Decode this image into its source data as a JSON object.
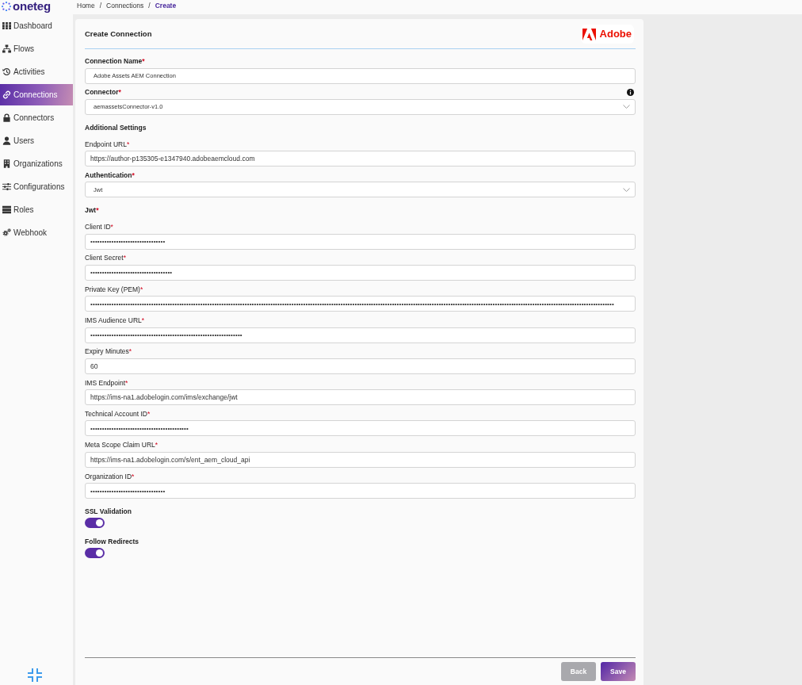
{
  "header": {
    "logo": "oneteg",
    "breadcrumb": [
      {
        "label": "Home",
        "selected": false,
        "separator": "/"
      },
      {
        "label": "Connections",
        "selected": false,
        "separator": "/"
      },
      {
        "label": "Create",
        "selected": true
      }
    ]
  },
  "sidebar": {
    "items": [
      {
        "label": "Dashboard",
        "selected": false
      },
      {
        "label": "Flows",
        "selected": false
      },
      {
        "label": "Activities",
        "selected": false
      },
      {
        "label": "Connections",
        "selected": true
      },
      {
        "label": "Connectors",
        "selected": false
      },
      {
        "label": "Users",
        "selected": false
      },
      {
        "label": "Organizations",
        "selected": false
      },
      {
        "label": "Configurations",
        "selected": false
      },
      {
        "label": "Roles",
        "selected": false
      },
      {
        "label": "Webhook",
        "selected": false
      }
    ]
  },
  "form": {
    "title": "Create Connection",
    "brand": "Adobe",
    "fields": [
      {
        "kind": "text",
        "bold": true,
        "label": "Connection Name",
        "required_mark": "*",
        "value": "Adobe Assets AEM Connection"
      },
      {
        "kind": "select",
        "bold": true,
        "label": "Connector",
        "required_mark": "*",
        "info": true,
        "value": "aemassetsConnector-v1.0"
      },
      {
        "kind": "heading",
        "bold": true,
        "label": "Additional Settings"
      },
      {
        "kind": "text",
        "bold": false,
        "label": "Endpoint URL",
        "required_mark": "*",
        "value": "https://author-p135305-e1347940.adobeaemcloud.com"
      },
      {
        "kind": "select",
        "bold": true,
        "label": "Authentication",
        "required_mark": "*",
        "value": "Jwt"
      },
      {
        "kind": "heading",
        "bold": true,
        "label": "Jwt",
        "required_mark": "*"
      },
      {
        "kind": "password",
        "bold": false,
        "label": "Client ID",
        "required_mark": "*",
        "value": "••••••••••••••••••••••••••••••••"
      },
      {
        "kind": "password",
        "bold": false,
        "label": "Client Secret",
        "required_mark": "*",
        "value": "•••••••••••••••••••••••••••••••••••"
      },
      {
        "kind": "password",
        "bold": false,
        "label": "Private Key (PEM)",
        "required_mark": "*",
        "value": "••••••••••••••••••••••••••••••••••••••••••••••••••••••••••••••••••••••••••••••••••••••••••••••••••••••••••••••••••••••••••••••••••••••••••••••••••••••••••••••••••••••••••••••••••••••••••••••••••••••••••••••••••••••••••••••••"
      },
      {
        "kind": "password",
        "bold": false,
        "label": "IMS Audience URL",
        "required_mark": "*",
        "value": "•••••••••••••••••••••••••••••••••••••••••••••••••••••••••••••••••"
      },
      {
        "kind": "text",
        "bold": false,
        "label": "Expiry Minutes",
        "required_mark": "*",
        "value": "60"
      },
      {
        "kind": "text",
        "bold": false,
        "label": "IMS Endpoint",
        "required_mark": "*",
        "value": "https://ims-na1.adobelogin.com/ims/exchange/jwt"
      },
      {
        "kind": "password",
        "bold": false,
        "label": "Technical Account ID",
        "required_mark": "*",
        "value": "••••••••••••••••••••••••••••••••••••••••••"
      },
      {
        "kind": "text",
        "bold": false,
        "label": "Meta Scope Claim URL",
        "required_mark": "*",
        "value": "https://ims-na1.adobelogin.com/s/ent_aem_cloud_api"
      },
      {
        "kind": "password",
        "bold": false,
        "label": "Organization ID",
        "required_mark": "*",
        "value": "••••••••••••••••••••••••••••••••"
      },
      {
        "kind": "toggle",
        "bold": true,
        "label": "SSL Validation",
        "on": true
      },
      {
        "kind": "toggle",
        "bold": true,
        "label": "Follow Redirects",
        "on": true
      }
    ]
  },
  "footer": {
    "buttons": [
      {
        "label": "Back",
        "kind": "secondary"
      },
      {
        "label": "Save",
        "kind": "primary"
      }
    ]
  }
}
